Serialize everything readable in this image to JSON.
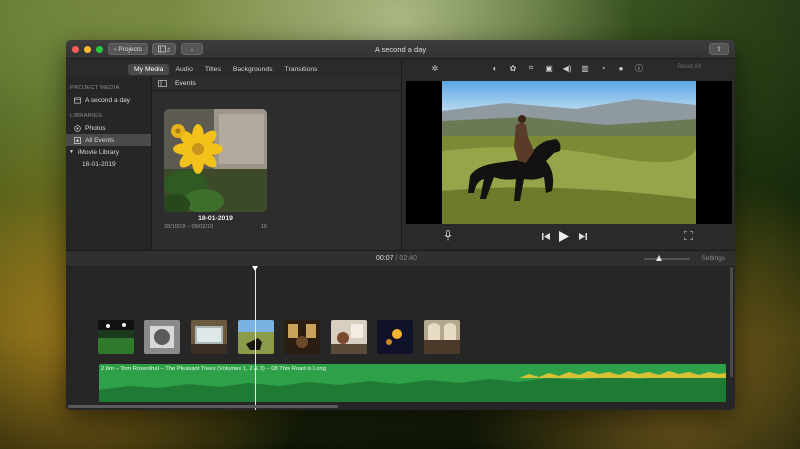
{
  "window": {
    "title": "A second a day"
  },
  "titlebar": {
    "projects_label": "Projects"
  },
  "tabs": [
    {
      "label": "My Media",
      "active": true
    },
    {
      "label": "Audio",
      "active": false
    },
    {
      "label": "Titles",
      "active": false
    },
    {
      "label": "Backgrounds",
      "active": false
    },
    {
      "label": "Transitions",
      "active": false
    }
  ],
  "sidebar": {
    "project_media_heading": "PROJECT MEDIA",
    "project_item": "A second a day",
    "libraries_heading": "LIBRARIES",
    "photos": "Photos",
    "all_events": "All Events",
    "library": "iMovie Library",
    "library_event": "18-01-2019"
  },
  "browser": {
    "events_label": "Events",
    "event_card": {
      "title": "18-01-2019",
      "date_range": "28/10/18 – 05/02/19",
      "count": "16"
    }
  },
  "viewer": {
    "reset_all": "Reset All"
  },
  "timeline": {
    "current_time": "00:07",
    "separator": "/",
    "duration": "02:40",
    "settings_label": "Settings",
    "audio_clip_label": "2.6m – Tom Rosenthal – The Pleasant Trees (Volumes 1, 2 & 3) – 08 This Road is Long"
  },
  "colors": {
    "close": "#fd5e57",
    "minimize": "#febc2e",
    "zoom": "#28c840",
    "audio_track": "#2fa04a"
  }
}
